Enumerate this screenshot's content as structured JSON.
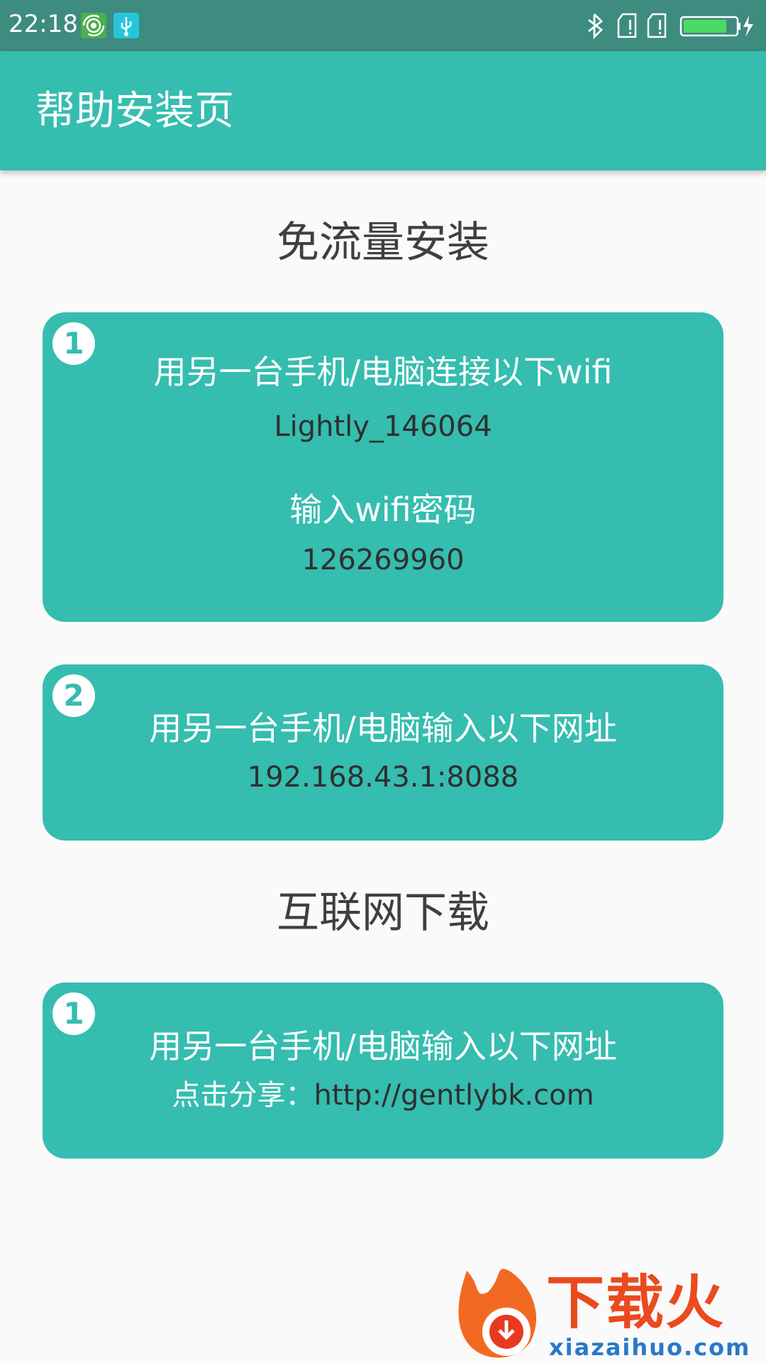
{
  "status_bar": {
    "time": "22:18",
    "icons_left": [
      "hotspot-icon",
      "usb-icon"
    ],
    "icons_right": [
      "bluetooth-icon",
      "sim-alert-icon",
      "sim-alert-icon",
      "battery-charging-icon"
    ]
  },
  "toolbar": {
    "title": "帮助安装页"
  },
  "section1": {
    "title": "免流量安装",
    "cards": [
      {
        "badge": "1",
        "line1": "用另一台手机/电脑连接以下wifi",
        "line2": "Lightly_146064",
        "line3": "输入wifi密码",
        "line4": "126269960"
      },
      {
        "badge": "2",
        "line1": "用另一台手机/电脑输入以下网址",
        "line2": "192.168.43.1:8088"
      }
    ]
  },
  "section2": {
    "title": "互联网下载",
    "cards": [
      {
        "badge": "1",
        "line1": "用另一台手机/电脑输入以下网址",
        "share_label": "点击分享：",
        "share_url": "http://gentlybk.com"
      }
    ]
  },
  "watermark": {
    "text": "下载火",
    "sub": "xiazaihuo.com"
  },
  "colors": {
    "accent": "#35bdaf",
    "statusbar": "#3e8b80",
    "background": "#fafafa"
  }
}
